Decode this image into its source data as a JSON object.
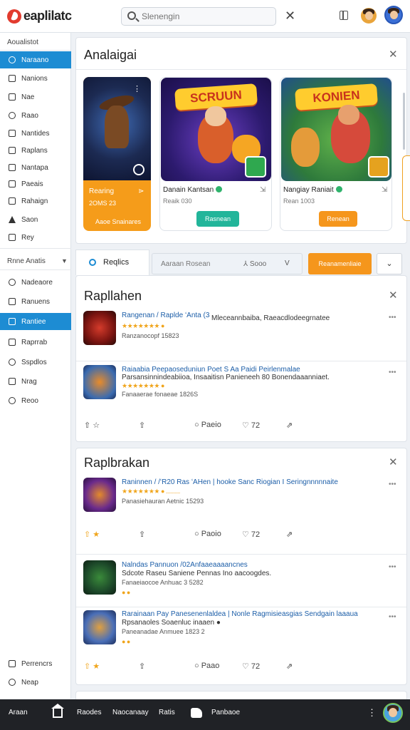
{
  "app": {
    "name": "eaplilatc"
  },
  "search": {
    "placeholder": "Slenengin",
    "value": ""
  },
  "sidebar": {
    "heading": "Aoualistot",
    "items": [
      {
        "label": "Naraano",
        "active": true
      },
      {
        "label": "Nanions"
      },
      {
        "label": "Nae"
      },
      {
        "label": "Raao"
      },
      {
        "label": "Nantides"
      },
      {
        "label": "Raplans"
      },
      {
        "label": "Nantapa"
      },
      {
        "label": "Paeais"
      },
      {
        "label": "Rahaign"
      },
      {
        "label": "Saon"
      },
      {
        "label": "Rey"
      }
    ],
    "section2_heading": "Rnne Anatis",
    "items2": [
      {
        "label": "Nadeaore"
      },
      {
        "label": "Ranuens"
      },
      {
        "label": "Rantiee",
        "active": true
      },
      {
        "label": "Raprrab"
      },
      {
        "label": "Sspdlos"
      },
      {
        "label": "Nrag"
      },
      {
        "label": "Reoo"
      }
    ],
    "footer_items": [
      {
        "label": "Perrencrs"
      },
      {
        "label": "Neap"
      }
    ]
  },
  "featured": {
    "title": "Analaigai",
    "games": [
      {
        "art_title": "",
        "tag": "Rearing",
        "sub": "2OMS 23",
        "foot": "Aaoe Snainares",
        "more": "⋗"
      },
      {
        "art_title": "SCRUUN",
        "name": "Danain Kantsan",
        "sub": "Reaik 030",
        "extra": "⇲",
        "button": "Rasnean"
      },
      {
        "art_title": "KONIEN",
        "name": "Nangiay Raniait",
        "sub": "Rean 1003",
        "extra": "⇲",
        "button": "Renean"
      }
    ]
  },
  "filter": {
    "tab": "Reqlics",
    "input_left": "Aaraan Rosean",
    "input_mid": "⅄ Sooo",
    "input_right": "V",
    "button": "Reanamenliaie",
    "dropdown": "⌄"
  },
  "feed1": {
    "title": "Rapllahen",
    "rows": [
      {
        "line1": "Rangenan / Raplde ʻAnta (3ai)",
        "line1b": "Mleceannbaiba, Raeacdlodeegrnatee",
        "stars": "★★★★★★★ ●",
        "meta": "Ranzanocopf 15823"
      },
      {
        "line1": "Raiaabia Peepaoseduniun Poet S Aa Paidi Peirlenmalae",
        "line2": "Parsansinnindeabiioa, Insaaitisn Panieneeh 80 Bonendaaanniaet.",
        "stars": "★★★★★★★ ●",
        "meta": "Fanaaerae fonaeae 1826S"
      }
    ],
    "actions": {
      "a1": "⇧ ☆",
      "a2": "⇪",
      "a3": "○ Paeio",
      "a4": "♡ 72",
      "a5": "⇗"
    }
  },
  "feed2": {
    "title": "Raplbrakan",
    "rows": [
      {
        "line1": "Raninnen / /ʻR20 Ras ʻAHen | hooke Sanc Riogian I Seringnnnnnaite",
        "stars": "★★★★★★★ ● ..........",
        "meta": "Panasiehauran Aetnic 15293"
      },
      {
        "line1": "Nalndas Pannuon /02Anfaaeaaaancnes",
        "line2": "Sdcote Raseu Saniene Pennas Ino aacoogdes.",
        "meta": "Fanaeiaocoe Anhuac 3 5282",
        "badge": "● ●"
      },
      {
        "line1": "Rarainaan Pay Panesenenlaldea | Nonle Ragmisieasgias Sendgain laaaua",
        "line2": "Rpsanaoles Soaenluc inaaen ●",
        "meta": "Paneanadae Anmuee 1823 2",
        "badge": "● ●"
      }
    ],
    "actions1": {
      "a1": "⇧ ★",
      "a2": "⇪",
      "a3": "○ Paoio",
      "a4": "♡ 72",
      "a5": "⇗"
    },
    "actions2": {
      "a1": "⇧ ★",
      "a2": "⇪",
      "a3": "○ Paao",
      "a4": "♡ 72",
      "a5": "⇗"
    }
  },
  "bottombar": {
    "left": "Araan",
    "items": [
      "Raodes",
      "Naocanaay",
      "Ratis",
      "Panbaoe"
    ],
    "more": "⋮"
  }
}
